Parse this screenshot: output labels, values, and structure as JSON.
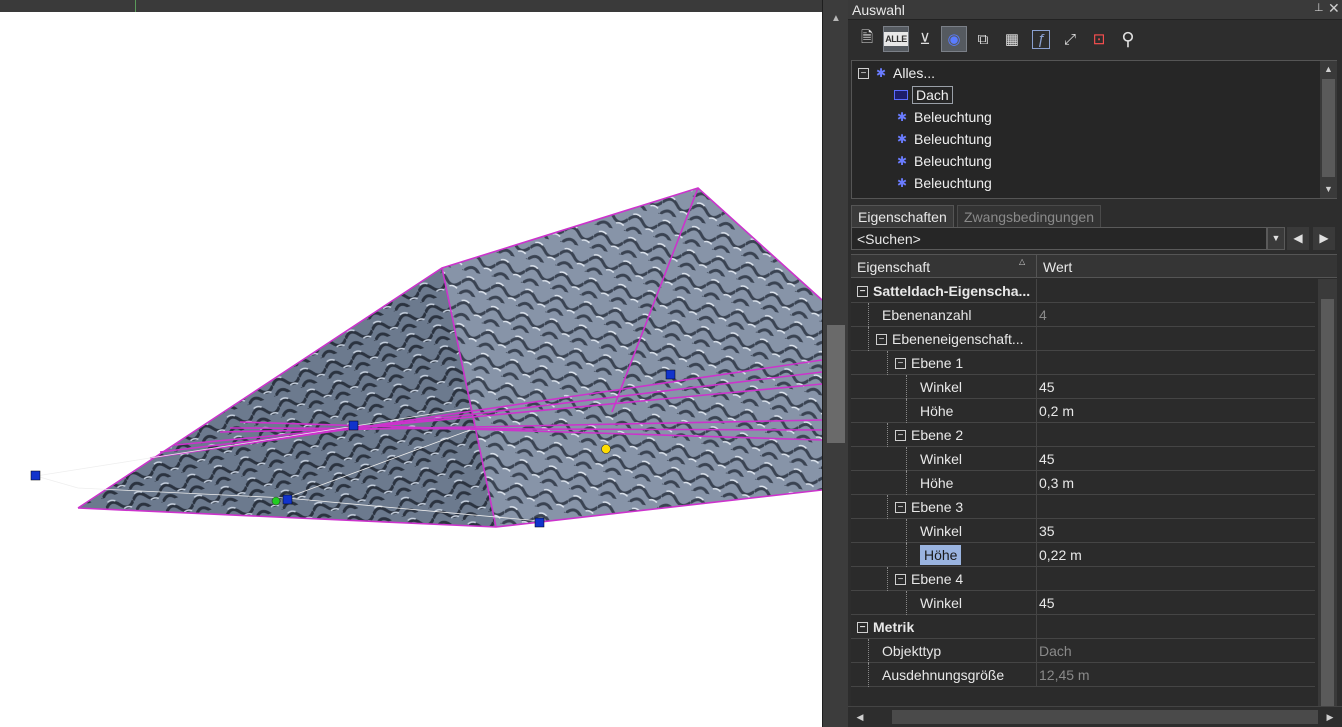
{
  "panel": {
    "title": "Auswahl",
    "pin_glyph": "⊥",
    "close_glyph": "✕"
  },
  "toolbar": {
    "buttons": [
      {
        "name": "properties-icon",
        "glyph": "🗎"
      },
      {
        "name": "select-all-icon",
        "glyph": "ALLE",
        "active": true
      },
      {
        "name": "filter-icon",
        "glyph": "⊻"
      },
      {
        "name": "highlight-icon",
        "glyph": "◉",
        "active": true
      },
      {
        "name": "copy-icon",
        "glyph": "⧉"
      },
      {
        "name": "table-icon",
        "glyph": "▦"
      },
      {
        "name": "function-icon",
        "glyph": "ƒ"
      },
      {
        "name": "transform-icon",
        "glyph": "⤢"
      },
      {
        "name": "select-box-icon",
        "glyph": "⊡"
      },
      {
        "name": "search-icon",
        "glyph": "⚲"
      }
    ]
  },
  "tree": {
    "root_label": "Alles...",
    "items": [
      {
        "label": "Dach",
        "icon": "roof-icon"
      },
      {
        "label": "Beleuchtung",
        "icon": "light-icon"
      },
      {
        "label": "Beleuchtung",
        "icon": "light-icon"
      },
      {
        "label": "Beleuchtung",
        "icon": "light-icon"
      },
      {
        "label": "Beleuchtung",
        "icon": "light-icon"
      }
    ]
  },
  "tabs": [
    {
      "label": "Eigenschaften"
    },
    {
      "label": "Zwangsbedingungen"
    }
  ],
  "search": {
    "value": "<Suchen>"
  },
  "grid": {
    "col_property": "Eigenschaft",
    "col_value": "Wert",
    "rows": [
      {
        "label": "Satteldach-Eigenscha...",
        "value": "",
        "indent": 0,
        "expander": true,
        "bold": true
      },
      {
        "label": "Ebenenanzahl",
        "value": "4",
        "indent": 1,
        "dim": true
      },
      {
        "label": "Ebeneneigenschaft...",
        "value": "",
        "indent": 1,
        "expander": true
      },
      {
        "label": "Ebene 1",
        "value": "",
        "indent": 2,
        "expander": true
      },
      {
        "label": "Winkel",
        "value": "45",
        "indent": 3
      },
      {
        "label": "Höhe",
        "value": "0,2 m",
        "indent": 3
      },
      {
        "label": "Ebene 2",
        "value": "",
        "indent": 2,
        "expander": true
      },
      {
        "label": "Winkel",
        "value": "45",
        "indent": 3
      },
      {
        "label": "Höhe",
        "value": "0,3 m",
        "indent": 3
      },
      {
        "label": "Ebene 3",
        "value": "",
        "indent": 2,
        "expander": true
      },
      {
        "label": "Winkel",
        "value": "35",
        "indent": 3
      },
      {
        "label": "Höhe",
        "value": "0,22 m",
        "indent": 3,
        "selected": true
      },
      {
        "label": "Ebene 4",
        "value": "",
        "indent": 2,
        "expander": true
      },
      {
        "label": "Winkel",
        "value": "45",
        "indent": 3
      },
      {
        "label": "Metrik",
        "value": "",
        "indent": 0,
        "expander": true,
        "bold": true
      },
      {
        "label": "Objekttyp",
        "value": "Dach",
        "indent": 1,
        "dim": true
      },
      {
        "label": "Ausdehnungsgröße",
        "value": "12,45 m",
        "indent": 1,
        "dim": true
      }
    ]
  },
  "colors": {
    "wireframe": "#cc33cc",
    "handle": "#1133cc",
    "selection_highlight": "#9ab4e0"
  }
}
